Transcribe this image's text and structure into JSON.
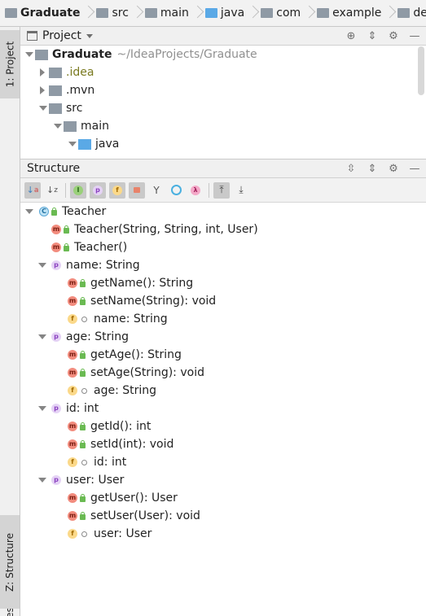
{
  "breadcrumb": [
    "Graduate",
    "src",
    "main",
    "java",
    "com",
    "example",
    "demo"
  ],
  "left_strip": {
    "project_tab": "1: Project",
    "structure_tab": "Z: Structure",
    "extra_tab": "es"
  },
  "project_panel": {
    "title": "Project",
    "tree": [
      {
        "label": "Graduate",
        "path": "~/IdeaProjects/Graduate"
      },
      {
        "label": ".idea"
      },
      {
        "label": ".mvn"
      },
      {
        "label": "src"
      },
      {
        "label": "main"
      },
      {
        "label": "java"
      }
    ]
  },
  "structure_panel": {
    "title": "Structure",
    "class_name": "Teacher",
    "constructors": [
      "Teacher(String, String, int, User)",
      "Teacher()"
    ],
    "properties": [
      {
        "label": "name: String",
        "getter": "getName(): String",
        "setter": "setName(String): void",
        "field": "name: String"
      },
      {
        "label": "age: String",
        "getter": "getAge(): String",
        "setter": "setAge(String): void",
        "field": "age: String"
      },
      {
        "label": "id: int",
        "getter": "getId(): int",
        "setter": "setId(int): void",
        "field": "id: int"
      },
      {
        "label": "user: User",
        "getter": "getUser(): User",
        "setter": "setUser(User): void",
        "field": "user: User"
      }
    ]
  },
  "icons": {
    "class": "C",
    "method": "m",
    "property": "p",
    "field": "f",
    "lambda": "λ"
  },
  "colors": {
    "folder_gray": "#8f9aa5",
    "folder_blue": "#5aa9e6",
    "method_icon": "#f28c7e",
    "field_icon": "#fbd98a",
    "property_icon": "#e5d3f5",
    "public_lock": "#6aba52"
  }
}
